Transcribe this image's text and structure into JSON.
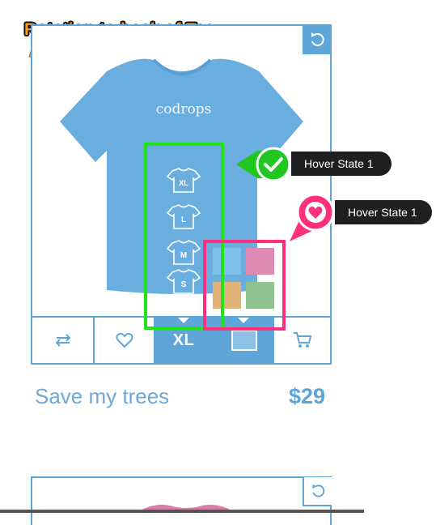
{
  "annotation": {
    "title": "Rotation to back of Tee",
    "hover_state_1": "Hover State 1",
    "hover_state_2": "Hover State 1"
  },
  "product": {
    "print_text": "codrops",
    "name": "Save my trees",
    "price": "$29",
    "selected_size": "XL",
    "sizes": [
      "XL",
      "L",
      "M",
      "S"
    ],
    "tee_color": "#6aaee0",
    "colors": [
      "#7fc0eb",
      "#de8ab4",
      "#e1b378",
      "#8fc191"
    ]
  },
  "icons": {
    "rotate": "rotate-icon",
    "compare": "compare-arrows-icon",
    "favorite": "heart-icon",
    "cart": "cart-icon",
    "checkmark": "checkmark-icon",
    "heart_badge": "heart-icon"
  },
  "colors": {
    "accent": "#5fa6d8",
    "annotation_orange": "#ff9a1f",
    "highlight_green": "#22e21a",
    "highlight_pink": "#ff2f7e"
  }
}
